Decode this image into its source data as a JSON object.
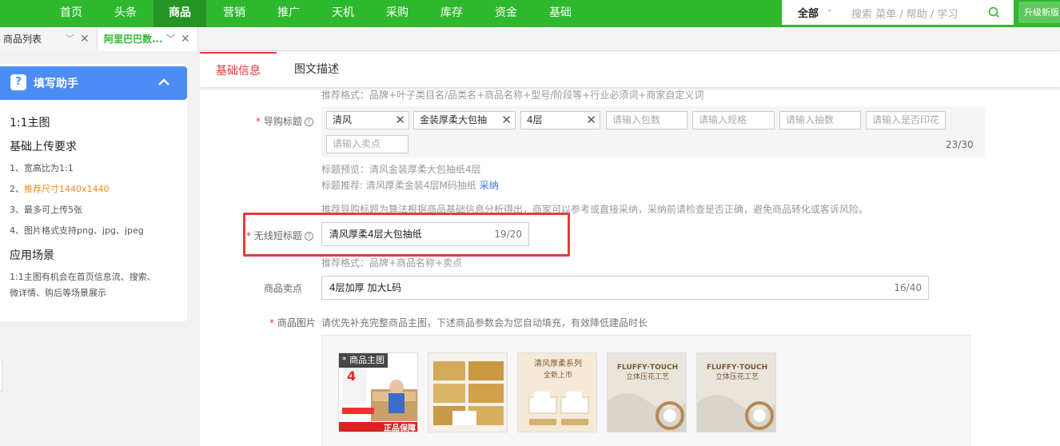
{
  "topnav": {
    "items": [
      "首页",
      "头条",
      "商品",
      "营销",
      "推广",
      "天机",
      "采购",
      "库存",
      "资金",
      "基础"
    ],
    "active_index": 2,
    "search_scope": "全部",
    "search_placeholder": "搜索 菜单 / 帮助 / 学习",
    "upgrade_label": "升级新版"
  },
  "tabs": [
    {
      "label": "商品列表"
    },
    {
      "label": "阿里巴巴数..."
    }
  ],
  "helper": {
    "title": "填写助手",
    "section1": "1:1主图",
    "section2": "基础上传要求",
    "req1": "1、宽高比为1:1",
    "req2_prefix": "2、",
    "req2_highlight": "推荐尺寸1440x1440",
    "req3": "3、最多可上传5张",
    "req4": "4、图片格式支持png、jpg、jpeg",
    "section3": "应用场景",
    "scene_line1": "1:1主图有机会在首页信息流、搜索、",
    "scene_line2": "微详情、购后等场景展示"
  },
  "subtabs": {
    "basic": "基础信息",
    "desc": "图文描述"
  },
  "form": {
    "format_hint_top": "推荐格式：品牌+叶子类目名/品类名+商品名称+型号/阶段等+行业必须词+商家自定义词",
    "guide_title_label": "导购标题",
    "chips": [
      {
        "text": "清风",
        "filled": true
      },
      {
        "text": "金装厚柔大包抽",
        "filled": true
      },
      {
        "text": "4层",
        "filled": true
      },
      {
        "text": "请输入包数",
        "filled": false
      },
      {
        "text": "请输入规格",
        "filled": false
      },
      {
        "text": "请输入抽数",
        "filled": false
      },
      {
        "text": "请输入是否印花",
        "filled": false
      },
      {
        "text": "请输入卖点",
        "filled": false
      }
    ],
    "title_counter": "23/30",
    "title_preview": "标题预览：清风金装厚柔大包抽纸4层",
    "title_recommend": "标题推荐: 清风厚柔金装4层M码抽纸",
    "adopt_link": "采纳",
    "algo_note": "推荐导购标题为算法根据商品基础信息分析得出，商家可以参考或直接采纳，采纳前请检查是否正确，避免商品转化或客诉风险。",
    "short_title_label": "无线短标题",
    "short_title_value": "清风厚柔4层大包抽纸",
    "short_title_counter": "19/20",
    "short_format_hint": "推荐格式：品牌+商品名称+卖点",
    "selling_label": "商品卖点",
    "selling_value": "4层加厚  加大L码",
    "selling_counter": "16/40",
    "image_label": "商品图片",
    "image_hint": "请优先补充完整商品主图，下述商品参数会为您自动填充，有效降低建品时长",
    "main_image_badge": "* 商品主图",
    "thumb1_big": "4",
    "thumb1_small": "正品保障",
    "thumb3_title": "清风厚柔系列",
    "thumb3_sub": "全新上市",
    "thumb4_title": "FLUFFY·TOUCH",
    "thumb4_sub": "立体压花工艺",
    "thumb5_title": "FLUFFY·TOUCH",
    "thumb5_sub": "立体压花工艺"
  },
  "colors": {
    "brand_green": "#2eb82e",
    "required_red": "#e4393c",
    "helper_blue": "#4b8cf5",
    "highlight_orange": "#f08c1e"
  }
}
